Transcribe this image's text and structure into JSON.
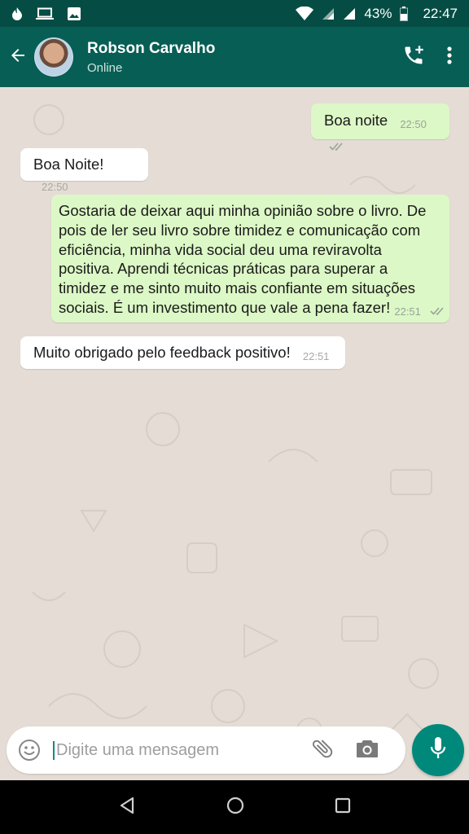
{
  "status_bar": {
    "battery_percent": "43%",
    "time": "22:47",
    "icons": [
      "flame-icon",
      "laptop-icon",
      "image-icon",
      "wifi-icon",
      "signal-icon",
      "signal-icon",
      "battery-icon"
    ]
  },
  "header": {
    "contact_name": "Robson Carvalho",
    "contact_status": "Online",
    "icons": [
      "back-arrow-icon",
      "avatar",
      "add-call-icon",
      "more-vert-icon"
    ]
  },
  "messages": [
    {
      "direction": "out",
      "text": "Boa noite",
      "time": "22:50",
      "read": true
    },
    {
      "direction": "in",
      "text": "Boa Noite!",
      "time": "22:50"
    },
    {
      "direction": "out",
      "text_lines": [
        "Gostaria de deixar aqui minha opinião sobre o livro. De",
        "pois de ler seu livro sobre timidez e comunicação com",
        "eficiência, minha vida social deu uma reviravolta",
        "positiva. Aprendi técnicas práticas para superar a",
        "timidez e me sinto muito mais confiante em situações",
        "sociais. É um investimento que vale a pena fazer!"
      ],
      "time": "22:51",
      "read": true
    },
    {
      "direction": "in",
      "text": "Muito obrigado pelo feedback positivo!",
      "time": "22:51"
    }
  ],
  "composer": {
    "placeholder": "Digite uma mensagem",
    "icons": [
      "emoji-icon",
      "attach-icon",
      "camera-icon",
      "mic-icon"
    ]
  },
  "colors": {
    "header": "#075e54",
    "status_bar": "#054d44",
    "outgoing_bubble": "#dcf8c6",
    "incoming_bubble": "#ffffff",
    "mic_button": "#00897b",
    "chat_background": "#e5ddd5"
  }
}
